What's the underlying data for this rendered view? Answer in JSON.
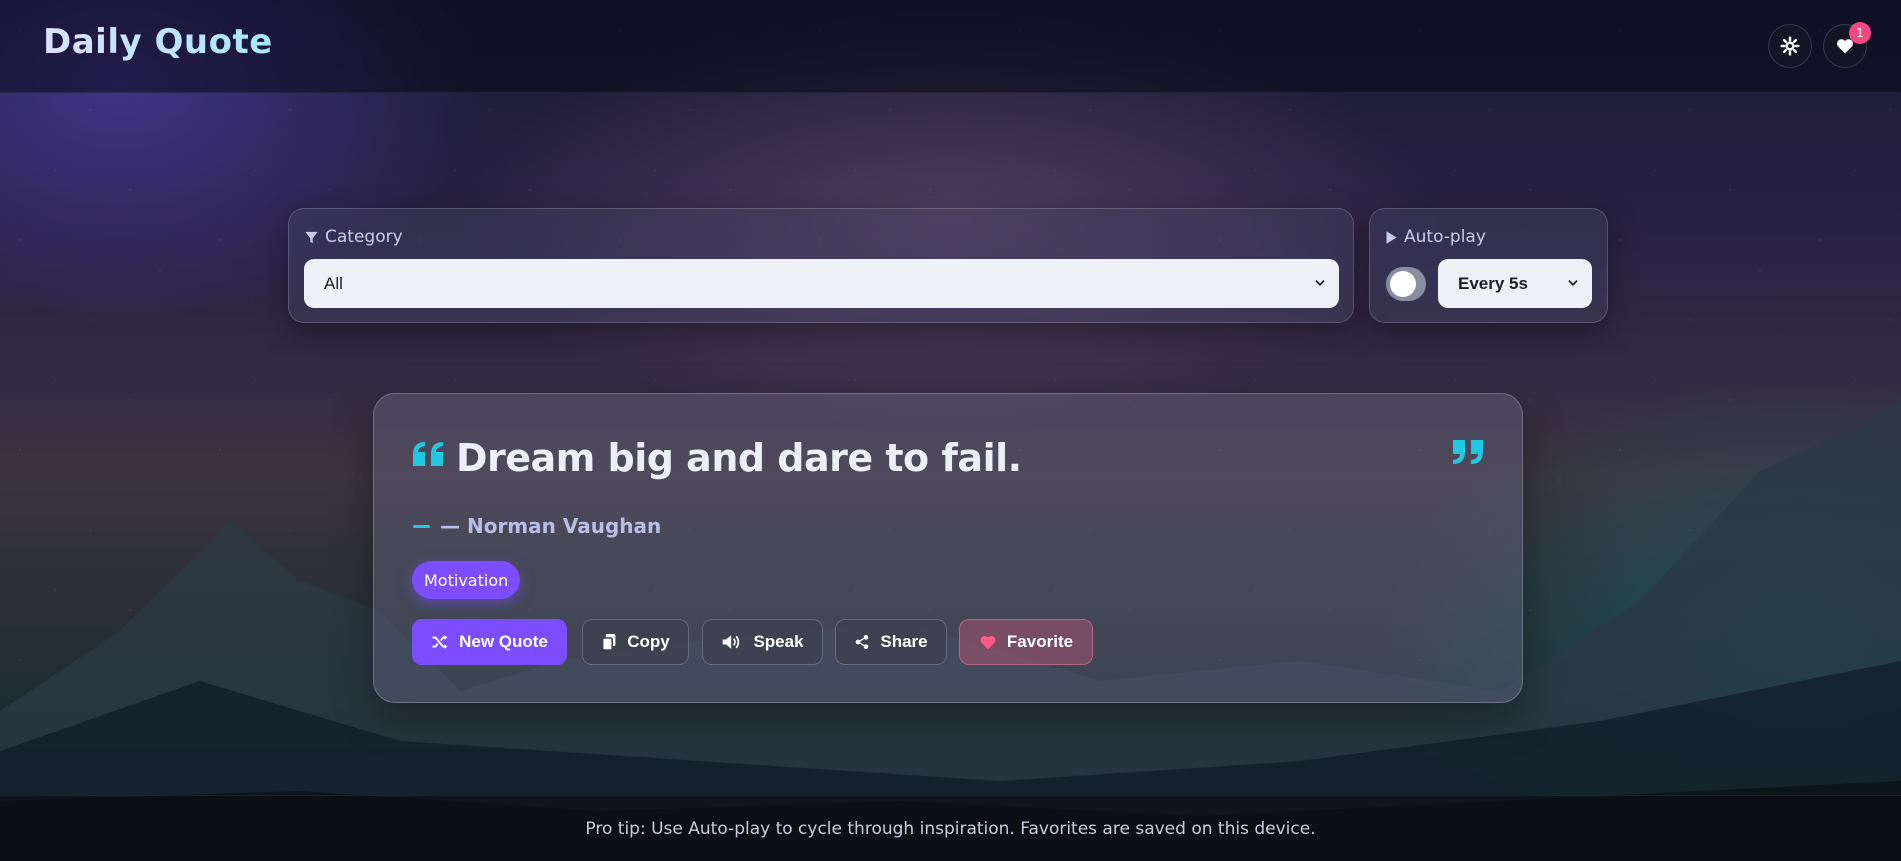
{
  "header": {
    "title": "Daily Quote",
    "theme_button_icon": "gear-icon",
    "favorites_button_icon": "heart-icon",
    "favorites_count": "1"
  },
  "filters": {
    "category_label": "Category",
    "category_value": "All",
    "autoplay_label": "Auto-play",
    "autoplay_enabled": false,
    "interval_value": "Every 5s"
  },
  "quote": {
    "text": "Dream big and dare to fail.",
    "author": "— Norman Vaughan",
    "tag": "Motivation"
  },
  "actions": {
    "new_quote": "New Quote",
    "copy": "Copy",
    "speak": "Speak",
    "share": "Share",
    "favorite": "Favorite"
  },
  "footer": {
    "tip": "Pro tip: Use Auto-play to cycle through inspiration. Favorites are saved on this device."
  },
  "colors": {
    "accent": "#7c4dff",
    "quote_mark": "#22c8e0",
    "badge": "#f0487f",
    "favorite_heart": "#ff5c8a"
  }
}
